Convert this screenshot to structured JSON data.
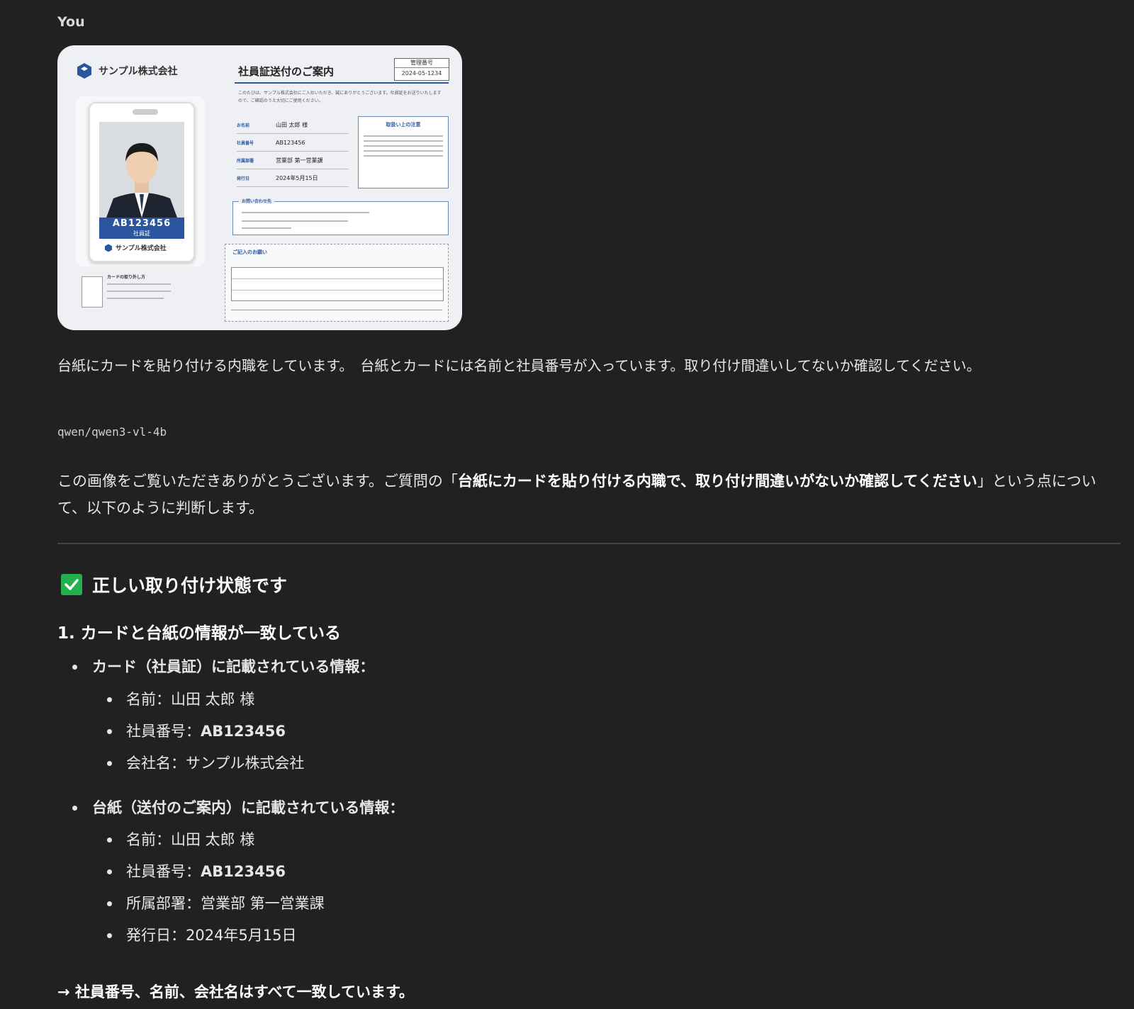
{
  "sender": "You",
  "attachment": {
    "company": "サンプル株式会社",
    "doc_title": "社員証送付のご案内",
    "control_label": "管理番号",
    "control_number": "2024-05-1234",
    "intro": "このたびは、サンプル株式会社にご入社いただき、誠にありがとうございます。社員証をお送りいたしますので、ご確認のうえ大切にご使用ください。",
    "fields": [
      {
        "key": "お名前",
        "value": "山田 太郎 様"
      },
      {
        "key": "社員番号",
        "value": "AB123456"
      },
      {
        "key": "所属部署",
        "value": "営業部 第一営業課"
      },
      {
        "key": "発行日",
        "value": "2024年5月15日"
      }
    ],
    "notes_title": "取扱い上の注意",
    "contact_title": "お問い合わせ先",
    "form_title": "ご記入のお願い",
    "howto_title": "カードの取り外し方",
    "card_id": "AB123456",
    "card_role": "社員証",
    "card_company": "サンプル株式会社"
  },
  "user_message": "台紙にカードを貼り付ける内職をしています。　台紙とカードには名前と社員番号が入っています。取り付け間違いしてないか確認してください。",
  "model_name": "qwen/qwen3-vl-4b",
  "reply": {
    "intro_pre": "この画像をご覧いただきありがとうございます。ご質問の「",
    "intro_bold": "台紙にカードを貼り付ける内職で、取り付け間違いがないか確認してください",
    "intro_post": "」という点について、以下のように判断します。",
    "heading": "正しい取り付け状態です",
    "subheading": "1. カードと台紙の情報が一致している",
    "card_section": {
      "title": "カード（社員証）に記載されている情報：",
      "items": [
        {
          "label": "名前：",
          "value": "山田 太郎 様"
        },
        {
          "label": "社員番号：",
          "value": "AB123456"
        },
        {
          "label": "会社名：",
          "value": "サンプル株式会社"
        }
      ]
    },
    "mount_section": {
      "title": "台紙（送付のご案内）に記載されている情報：",
      "items": [
        {
          "label": "名前：",
          "value": "山田 太郎 様"
        },
        {
          "label": "社員番号：",
          "value": "AB123456"
        },
        {
          "label": "所属部署：",
          "value": "営業部 第一営業課"
        },
        {
          "label": "発行日：",
          "value": "2024年5月15日"
        }
      ]
    },
    "conclusion": "→ 社員番号、名前、会社名はすべて一致しています。"
  },
  "colors": {
    "background": "#212121",
    "check": "#22b14c",
    "brand_blue": "#2c55a0"
  }
}
